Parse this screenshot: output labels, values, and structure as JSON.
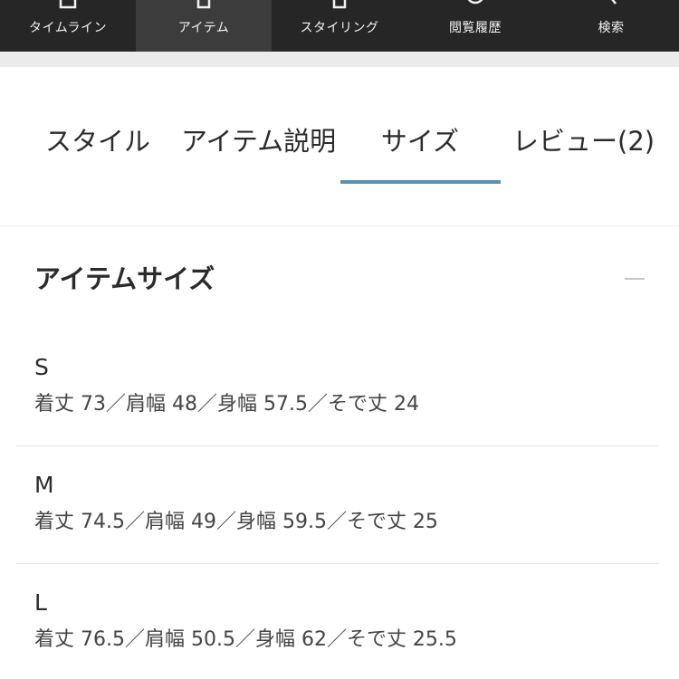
{
  "nav": {
    "items": [
      {
        "label": "タイムライン",
        "icon": "timeline-icon"
      },
      {
        "label": "アイテム",
        "icon": "item-icon"
      },
      {
        "label": "スタイリング",
        "icon": "styling-icon"
      },
      {
        "label": "閲覧履歴",
        "icon": "history-icon"
      },
      {
        "label": "検索",
        "icon": "search-icon"
      }
    ],
    "active_index": 1
  },
  "tabs": {
    "items": [
      {
        "label": "スタイル"
      },
      {
        "label": "アイテム説明"
      },
      {
        "label": "サイズ"
      },
      {
        "label": "レビュー(2)"
      }
    ],
    "active_index": 2,
    "accent_color": "#5b8fb0"
  },
  "size_section": {
    "title": "アイテムサイズ",
    "collapse_icon": "minus-icon",
    "sizes": [
      {
        "name": "S",
        "spec": "着丈 73／肩幅 48／身幅 57.5／そで丈 24"
      },
      {
        "name": "M",
        "spec": "着丈 74.5／肩幅 49／身幅 59.5／そで丈 25"
      },
      {
        "name": "L",
        "spec": "着丈 76.5／肩幅 50.5／身幅 62／そで丈 25.5"
      }
    ]
  }
}
